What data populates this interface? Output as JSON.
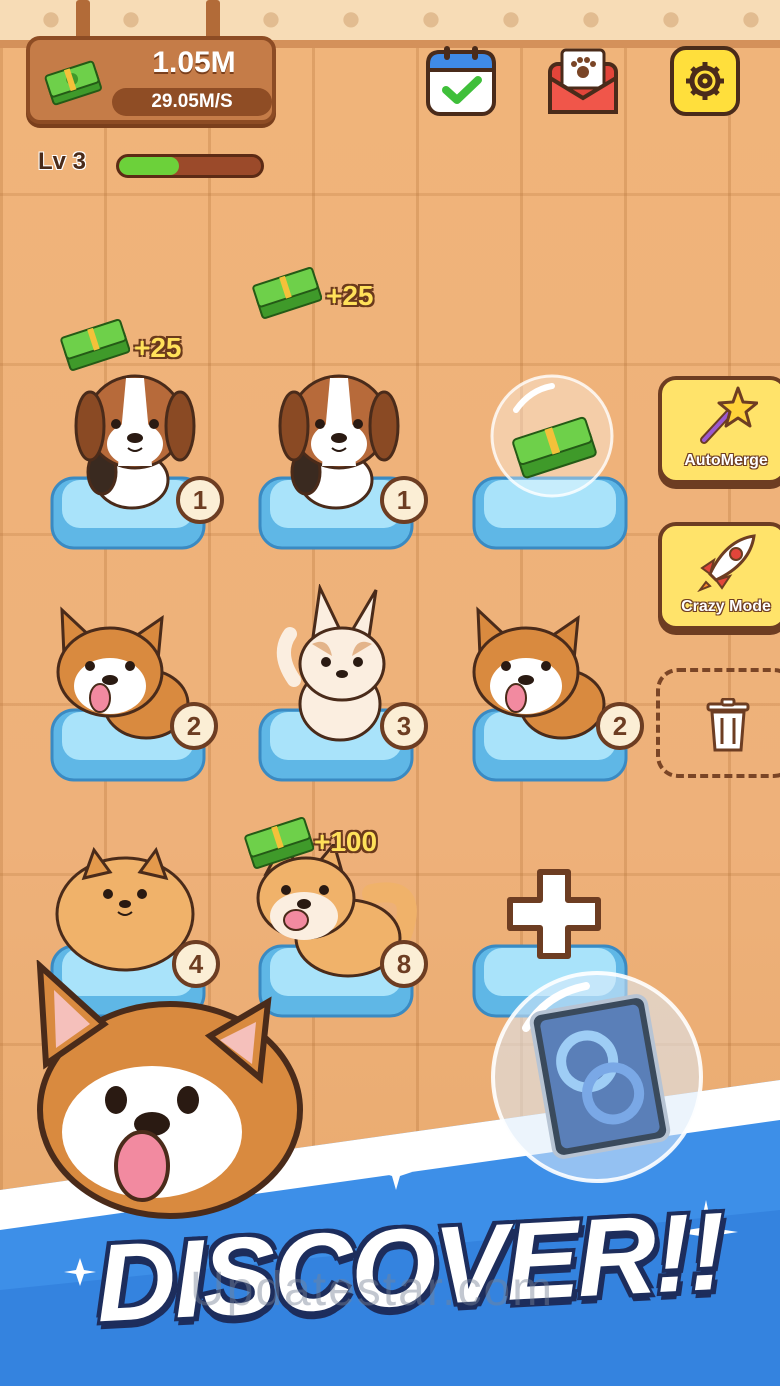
{
  "header": {
    "money_amount": "1.05M",
    "money_rate": "29.05M/S"
  },
  "level": {
    "label": "Lv 3",
    "progress": 0.42
  },
  "top_buttons": {
    "calendar": "calendar-check-icon",
    "mail": "paw-letter-icon",
    "settings": "gear-icon"
  },
  "earnings": {
    "row1_col1": "+25",
    "row1_col2": "+25",
    "row3_col2": "+100"
  },
  "pets": [
    {
      "breed": "beagle",
      "level": "1"
    },
    {
      "breed": "beagle",
      "level": "1"
    },
    {
      "breed": "cash-bubble",
      "level": ""
    },
    {
      "breed": "corgi",
      "level": "2"
    },
    {
      "breed": "chihuahua",
      "level": "3"
    },
    {
      "breed": "corgi",
      "level": "2"
    },
    {
      "breed": "pomeranian",
      "level": "4"
    },
    {
      "breed": "shiba",
      "level": "8"
    },
    {
      "breed": "add-slot",
      "level": ""
    }
  ],
  "side_buttons": {
    "automerge": "AutoMerge",
    "crazy_mode": "Crazy Mode"
  },
  "banner": {
    "title": "DISCOVER!!",
    "watermark": "Updatestar.com"
  },
  "colors": {
    "floor": "#efb57a",
    "panel": "#c57c48",
    "outline": "#6d3d22",
    "cushion": "#9fdcf6",
    "side_button": "#ffe36a",
    "progress": "#6cd13a",
    "banner_blue": "#3d8fe8"
  }
}
